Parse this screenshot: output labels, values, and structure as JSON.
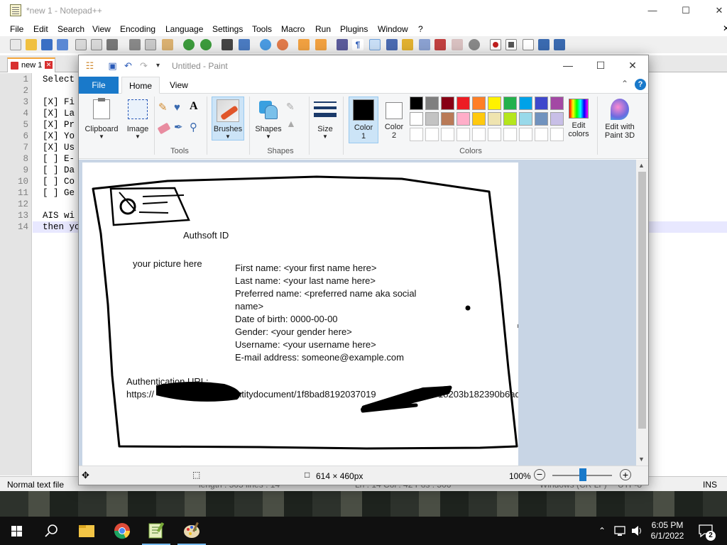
{
  "notepad": {
    "title": "*new 1 - Notepad++",
    "menu": [
      "File",
      "Edit",
      "Search",
      "View",
      "Encoding",
      "Language",
      "Settings",
      "Tools",
      "Macro",
      "Run",
      "Plugins",
      "Window",
      "?"
    ],
    "tab_label": "new 1",
    "line_numbers": [
      "1",
      "2",
      "3",
      "4",
      "5",
      "6",
      "7",
      "8",
      "9",
      "10",
      "11",
      "12",
      "13",
      "14"
    ],
    "lines": [
      "Select",
      "",
      "[X] Fi",
      "[X] La",
      "[X] Pr",
      "[X] Yo",
      "[X] Us",
      "[ ] E-",
      "[ ] Da",
      "[ ] Co",
      "[ ] Ge",
      "",
      "AIS wi",
      "then yo"
    ],
    "status_left": "Normal text file",
    "status_mid": "length : 505    lines : 14",
    "status_pos": "Ln : 14    Col : 42    Pos : 506",
    "status_eol": "Windows (CR LF)",
    "status_enc": "UTF-8",
    "status_ins": "INS"
  },
  "paint": {
    "title": "Untitled - Paint",
    "tabs": {
      "file": "File",
      "home": "Home",
      "view": "View"
    },
    "ribbon": {
      "clipboard": "Clipboard",
      "image": "Image",
      "tools": "Tools",
      "brushes": "Brushes",
      "shapes_btn": "Shapes",
      "shapes_group": "Shapes",
      "size": "Size",
      "color1": [
        "Color",
        "1"
      ],
      "color2": [
        "Color",
        "2"
      ],
      "edit_colors": [
        "Edit",
        "colors"
      ],
      "edit_3d": [
        "Edit with",
        "Paint 3D"
      ],
      "colors_group": "Colors"
    },
    "palette_row1": [
      "#000000",
      "#7f7f7f",
      "#880015",
      "#ed1c24",
      "#ff7f27",
      "#fff200",
      "#22b14c",
      "#00a2e8",
      "#3f48cc",
      "#a349a4"
    ],
    "palette_row2": [
      "#ffffff",
      "#c3c3c3",
      "#b97a57",
      "#ffaec9",
      "#ffc90e",
      "#efe4b0",
      "#b5e61d",
      "#99d9ea",
      "#7092be",
      "#c8bfe7"
    ],
    "canvas": {
      "heading": "Authsoft ID",
      "picture_placeholder": "your picture here",
      "fields": [
        "First name: <your first name here>",
        "Last name: <your last name here>",
        "Preferred name: <preferred name aka social",
        "name>",
        "Date of birth: 0000-00-00",
        "Gender: <your gender here>",
        "Username: <your username here>",
        "E-mail address: someone@example.com"
      ],
      "auth_label": "Authentication URL:",
      "auth_url_start": "https://",
      "auth_url_rest": "/identitydocument/1f8bad8192037019",
      "auth_url_end": "18203b182390b6ad"
    },
    "status_size": "614 × 460px",
    "zoom": "100%"
  },
  "taskbar": {
    "time": "6:05 PM",
    "date": "6/1/2022",
    "notifications": "2"
  }
}
